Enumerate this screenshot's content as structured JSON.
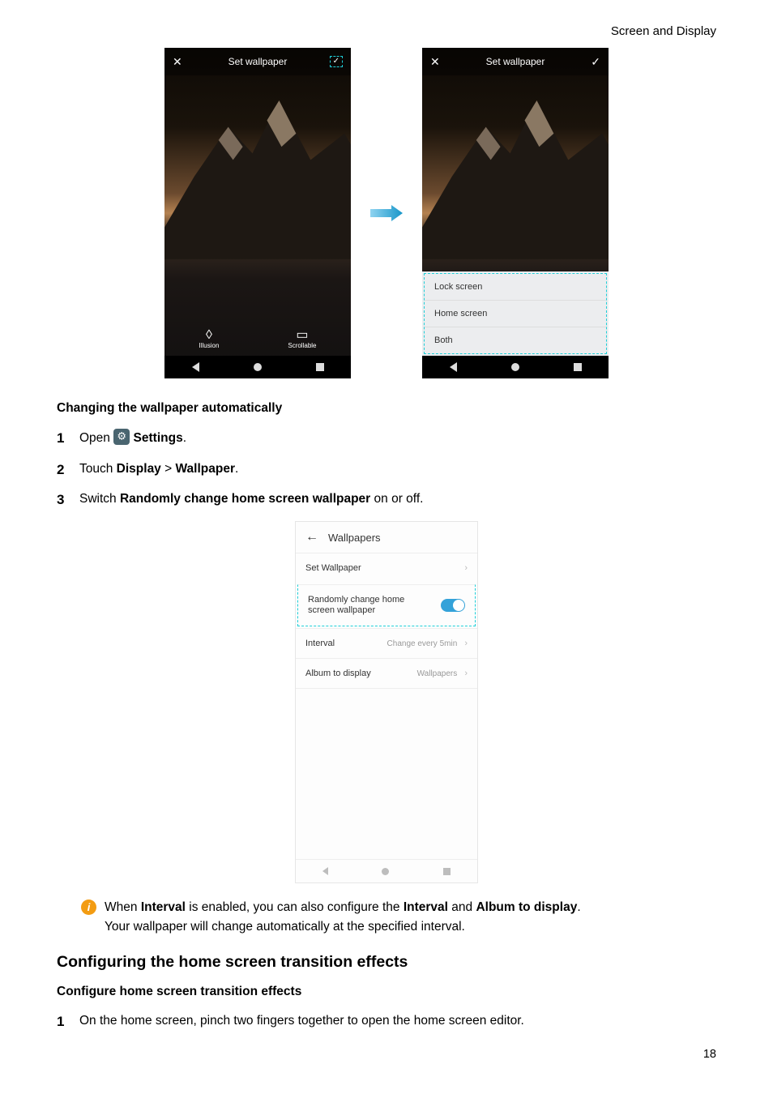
{
  "header": {
    "section": "Screen and Display"
  },
  "phone_a": {
    "title": "Set wallpaper",
    "icon_illusion_label": "Illusion",
    "icon_scrollable_label": "Scrollable"
  },
  "phone_b": {
    "title": "Set wallpaper",
    "options": [
      "Lock screen",
      "Home screen",
      "Both"
    ]
  },
  "sub1": {
    "heading": "Changing the wallpaper automatically"
  },
  "steps1": {
    "s1_pre": "Open ",
    "s1_post": " ",
    "s1_bold": "Settings",
    "s1_end": ".",
    "s2_pre": "Touch ",
    "s2_b1": "Display",
    "s2_mid": " > ",
    "s2_b2": "Wallpaper",
    "s2_end": ".",
    "s3_pre": "Switch ",
    "s3_b": "Randomly change home screen wallpaper",
    "s3_end": " on or off."
  },
  "wallpapers_screen": {
    "title": "Wallpapers",
    "row_set": "Set Wallpaper",
    "row_random": "Randomly change home screen wallpaper",
    "row_interval_label": "Interval",
    "row_interval_value": "Change every 5min",
    "row_album_label": "Album to display",
    "row_album_value": "Wallpapers"
  },
  "info": {
    "line1_pre": "When ",
    "line1_b1": "Interval",
    "line1_mid": " is enabled, you can also configure the ",
    "line1_b2": "Interval",
    "line1_mid2": " and ",
    "line1_b3": "Album to display",
    "line1_end": ".",
    "line2": "Your wallpaper will change automatically at the specified interval."
  },
  "section2": {
    "heading": "Configuring the home screen transition effects"
  },
  "sub2": {
    "heading": "Configure home screen transition effects"
  },
  "steps2": {
    "s1": "On the home screen, pinch two fingers together to open the home screen editor."
  },
  "page": {
    "num": "18"
  }
}
